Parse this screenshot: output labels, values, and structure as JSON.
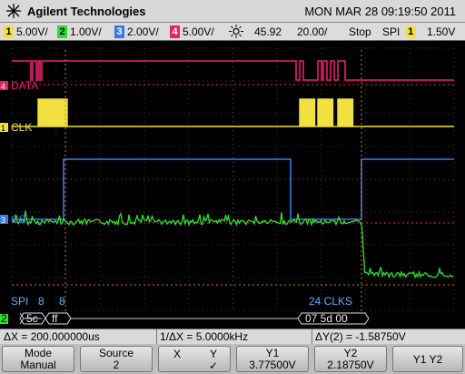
{
  "brand": {
    "name": "Agilent Technologies",
    "logo": "starburst-logo"
  },
  "datetime": "MON MAR 28 09:19:50 2011",
  "status": {
    "ch1": {
      "num": "1",
      "scale": "5.00V/",
      "color": "#f0e040"
    },
    "ch2": {
      "num": "2",
      "scale": "1.00V/",
      "color": "#2ee02e"
    },
    "ch3": {
      "num": "3",
      "scale": "2.00V/",
      "color": "#3a7ae8"
    },
    "ch4": {
      "num": "4",
      "scale": "5.00V/",
      "color": "#e8206a"
    },
    "trigger_icon": "trigger-sun-icon",
    "delay": "45.92",
    "timebase": "20.00/",
    "run_state": "Stop",
    "trigger_source": "SPI",
    "trigger_ch": "1",
    "trigger_level": "1.50V"
  },
  "labels": {
    "data": "DATA",
    "clk": "CLK",
    "cs": "CS",
    "data_num": "4",
    "clk_num": "1",
    "cs_num": "3",
    "ch2_marker": "2"
  },
  "decode": {
    "protocol": "SPI",
    "word_a": "8",
    "word_b": "8",
    "clks": "24 CLKS",
    "bus_num": "2",
    "byte1": "5c",
    "byte2": "ff",
    "packet": "07 5d 00"
  },
  "readouts": {
    "delta_x": "ΔX = 200.000000us",
    "inv_delta_x": "1/ΔX = 5.0000kHz",
    "delta_y": "ΔY(2) = -1.58750V"
  },
  "softkeys": {
    "mode_label": "Mode",
    "mode_value": "Manual",
    "source_label": "Source",
    "source_value": "2",
    "x_label": "X",
    "y_label": "Y",
    "y_check": "✓",
    "y1_label": "Y1",
    "y1_value": "3.77500V",
    "y2_label": "Y2",
    "y2_value": "2.18750V",
    "y1y2_label": "Y1 Y2"
  },
  "colors": {
    "ch1": "#f0e040",
    "ch2": "#2ee02e",
    "ch3": "#3a7ae8",
    "ch4": "#e8206a",
    "cursor": "#e07a20"
  }
}
